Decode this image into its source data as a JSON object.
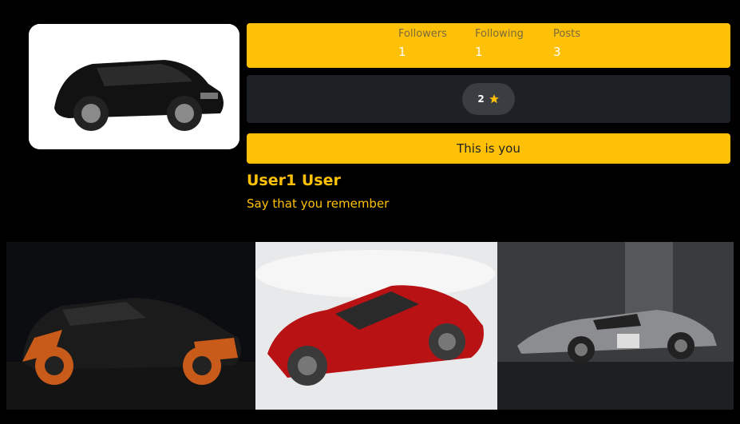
{
  "profile": {
    "name": "User1 User",
    "bio": "Say that you remember",
    "self_label": "This is you",
    "rating": "2"
  },
  "stats": [
    {
      "label": "Followers",
      "value": "1"
    },
    {
      "label": "Following",
      "value": "1"
    },
    {
      "label": "Posts",
      "value": "3"
    }
  ],
  "colors": {
    "accent": "#ffc107",
    "panel": "#1d2024",
    "background": "#000000"
  },
  "posts": [
    {
      "icon": "car-photo"
    },
    {
      "icon": "car-photo"
    },
    {
      "icon": "car-photo"
    }
  ]
}
